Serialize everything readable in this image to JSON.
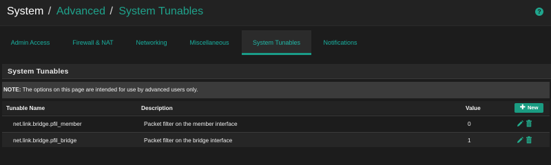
{
  "breadcrumb": {
    "root": "System",
    "sep1": "/",
    "level2": "Advanced",
    "sep2": "/",
    "level3": "System Tunables"
  },
  "header": {
    "help_icon": "question-circle-icon",
    "help_glyph": "?"
  },
  "tabs": [
    {
      "label": "Admin Access",
      "active": false
    },
    {
      "label": "Firewall & NAT",
      "active": false
    },
    {
      "label": "Networking",
      "active": false
    },
    {
      "label": "Miscellaneous",
      "active": false
    },
    {
      "label": "System Tunables",
      "active": true
    },
    {
      "label": "Notifications",
      "active": false
    }
  ],
  "panel": {
    "title": "System Tunables",
    "note_label": "NOTE:",
    "note_text": "The options on this page are intended for use by advanced users only."
  },
  "table": {
    "columns": {
      "name": "Tunable Name",
      "description": "Description",
      "value": "Value"
    },
    "new_button": {
      "label": "New",
      "icon": "plus-icon"
    },
    "rows": [
      {
        "name": "net.link.bridge.pfil_member",
        "description": "Packet filter on the member interface",
        "value": "0"
      },
      {
        "name": "net.link.bridge.pfil_bridge",
        "description": "Packet filter on the bridge interface",
        "value": "1"
      }
    ],
    "row_actions": [
      "pencil-icon",
      "trash-icon"
    ]
  },
  "colors": {
    "accent": "#1fa38c",
    "background": "#1c1c1c",
    "header": "#222222",
    "note_background": "#3b3b3b"
  }
}
